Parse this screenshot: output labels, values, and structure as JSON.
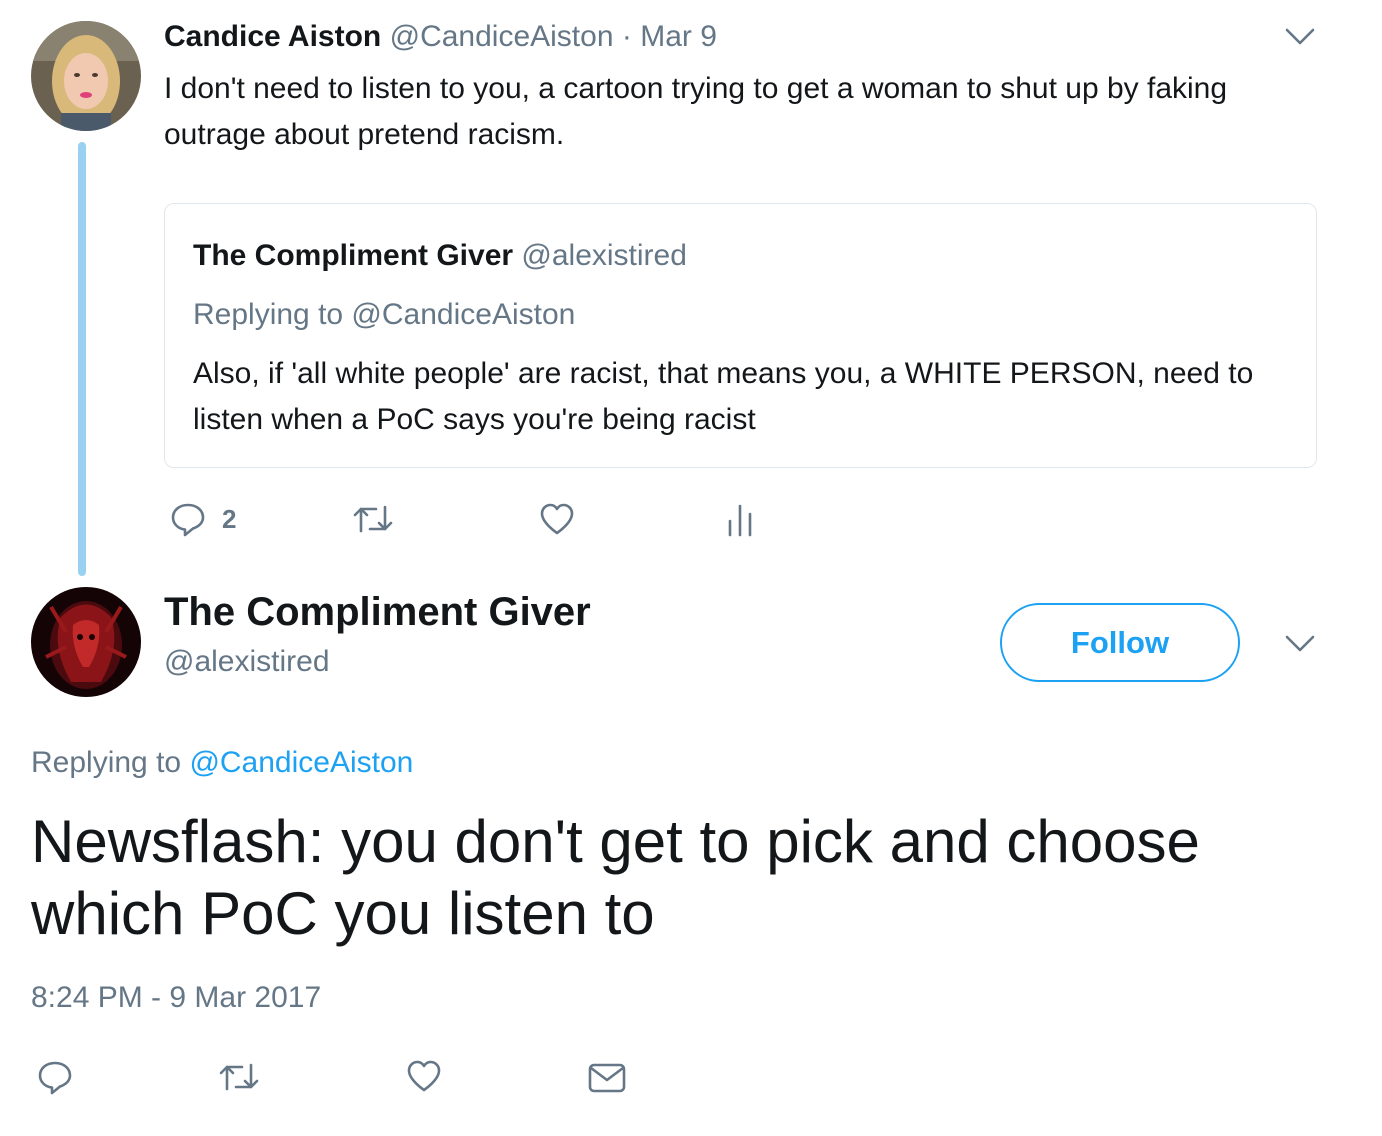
{
  "parent_tweet": {
    "author_name": "Candice Aiston",
    "author_handle": "@CandiceAiston",
    "separator": "·",
    "date": "Mar 9",
    "text": "I don't need to listen to you, a cartoon trying to get a woman to shut up by faking outrage about pretend racism.",
    "quoted_tweet": {
      "author_name": "The Compliment Giver",
      "author_handle": "@alexistired",
      "replying_to": "Replying to @CandiceAiston",
      "text": "Also, if 'all white people' are racist, that means you, a WHITE PERSON, need to listen when a PoC says you're being racist"
    },
    "actions": {
      "reply_count": "2",
      "icons": [
        "reply-icon",
        "retweet-icon",
        "like-icon",
        "analytics-icon"
      ]
    }
  },
  "main_tweet": {
    "author_name": "The Compliment Giver",
    "author_handle": "@alexistired",
    "follow_label": "Follow",
    "replying_prefix": "Replying to",
    "replying_mention": "@CandiceAiston",
    "text": "Newsflash: you don't get to pick and choose which PoC you listen to",
    "timestamp": "8:24 PM - 9 Mar 2017",
    "actions": {
      "icons": [
        "reply-icon",
        "retweet-icon",
        "like-icon",
        "direct-message-icon"
      ]
    }
  },
  "colors": {
    "link_blue": "#1da1f2",
    "secondary_text": "#657786",
    "primary_text": "#14171a",
    "thread_line": "#9ad1f0",
    "border": "#e1e8ed"
  }
}
